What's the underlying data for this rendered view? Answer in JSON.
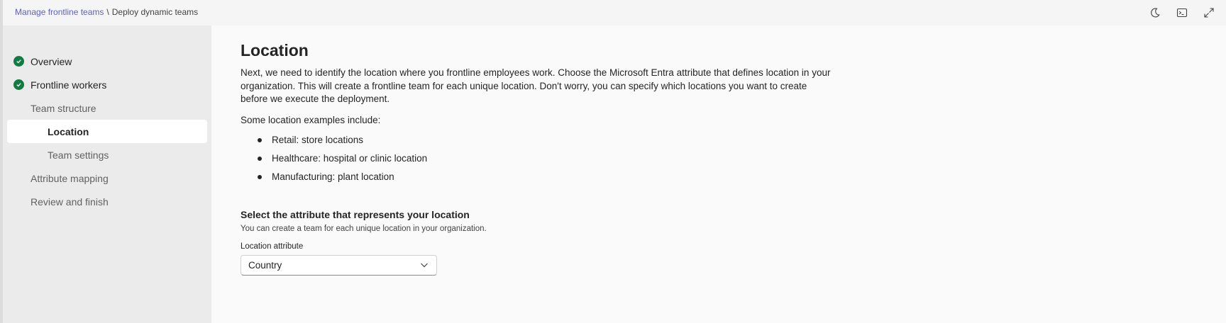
{
  "breadcrumb": {
    "parent": "Manage frontline teams",
    "separator": "\\",
    "current": "Deploy dynamic teams"
  },
  "top_icons": [
    "moon-icon",
    "terminal-icon",
    "expand-icon"
  ],
  "sidebar": {
    "items": [
      {
        "label": "Overview",
        "completed": true
      },
      {
        "label": "Frontline workers",
        "completed": true
      },
      {
        "label": "Team structure",
        "completed": false
      },
      {
        "label": "Location",
        "completed": false,
        "active": true
      },
      {
        "label": "Team settings",
        "completed": false
      },
      {
        "label": "Attribute mapping",
        "completed": false
      },
      {
        "label": "Review and finish",
        "completed": false
      }
    ]
  },
  "main": {
    "title": "Location",
    "intro": "Next, we need to identify the location where you frontline employees work. Choose the Microsoft Entra attribute that defines location in your organization. This will create a frontline team for each unique location. Don't worry, you can specify which locations you want to create before we execute the deployment.",
    "examples_label": "Some location examples include:",
    "examples": [
      "Retail: store locations",
      "Healthcare: hospital or clinic location",
      "Manufacturing: plant location"
    ],
    "section_title": "Select the attribute that represents your location",
    "section_subtitle": "You can create a team for each unique location in your organization.",
    "field_label": "Location attribute",
    "field_value": "Country"
  },
  "colors": {
    "accent": "#5b5fc7",
    "check_green": "#107c41",
    "sidebar_bg": "#ebebeb",
    "main_bg": "#fafafa"
  }
}
